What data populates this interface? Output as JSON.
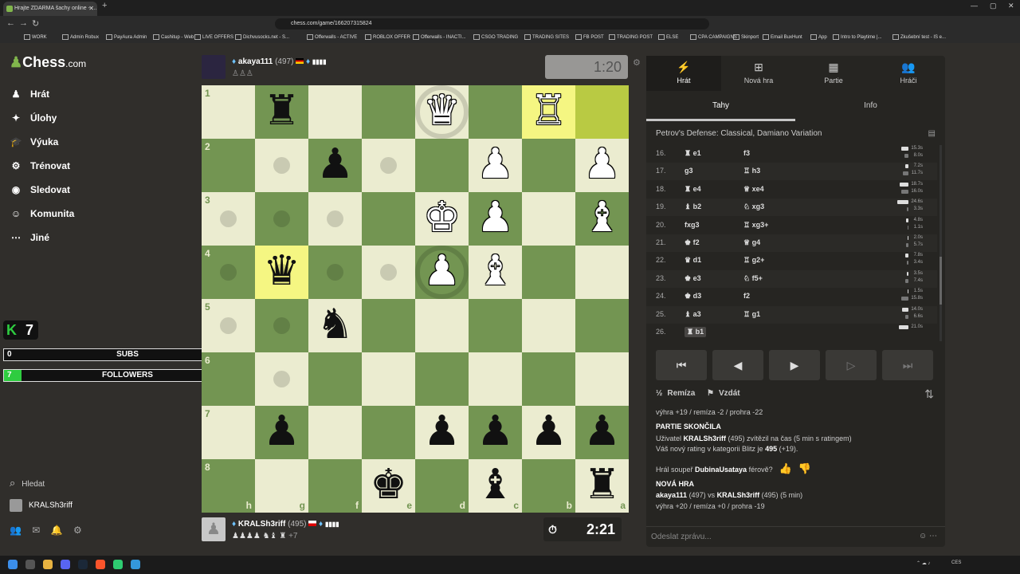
{
  "browser": {
    "tab_title": "Hrajte ZDARMA šachy online - …",
    "url": "chess.com/game/166207315824",
    "bookmarks": [
      "WORK",
      "Admin Robux",
      "PayAura Admin",
      "Cashitup - Web",
      "LIVE OFFERS",
      "Dichvusocks.net - S...",
      "Offerwalls - ACTIVE",
      "ROBLOX OFFER",
      "Offerwalls - INACTI...",
      "CSGO TRADING",
      "TRADING SITES",
      "FB POST",
      "TRADING POST",
      "ELSE",
      "CPA CAMPAIGNS",
      "Skinport",
      "Email BuxHunt",
      "App",
      "Intro to Playtime |...",
      "Zkušební test - IS e..."
    ]
  },
  "sidebar": {
    "logo_main": "Chess",
    "logo_dom": ".com",
    "items": [
      {
        "label": "Hrát",
        "icon": "play-icon"
      },
      {
        "label": "Úlohy",
        "icon": "puzzle-icon"
      },
      {
        "label": "Výuka",
        "icon": "learn-icon"
      },
      {
        "label": "Trénovat",
        "icon": "train-icon"
      },
      {
        "label": "Sledovat",
        "icon": "watch-icon"
      },
      {
        "label": "Komunita",
        "icon": "community-icon"
      },
      {
        "label": "Jiné",
        "icon": "more-icon"
      }
    ],
    "search": "Hledat",
    "username": "KRALSh3riff"
  },
  "overlay": {
    "k_count": "7",
    "subs": {
      "left": "0",
      "label": "SUBS",
      "right": "10",
      "progress": 0
    },
    "followers": {
      "left": "7",
      "label": "FOLLOWERS",
      "right": "100",
      "progress": 0.07
    }
  },
  "top_player": {
    "name": "akaya111",
    "rating": "(497)",
    "clock": "1:20",
    "captures": "♙♙♙"
  },
  "bottom_player": {
    "name": "KRALSh3riff",
    "rating": "(495)",
    "clock": "2:21",
    "captures": "♟♟♟♟ ♞♝ ♜",
    "diff": "+7"
  },
  "board": {
    "ranks": [
      "1",
      "2",
      "3",
      "4",
      "5",
      "6",
      "7",
      "8"
    ],
    "files": [
      "h",
      "g",
      "f",
      "e",
      "d",
      "c",
      "b",
      "a"
    ],
    "highlights": [
      "g4",
      "b1",
      "a1"
    ],
    "dots": [
      "g2",
      "e2",
      "h3",
      "g3",
      "f3",
      "h4",
      "g4_",
      "f4",
      "e4",
      "h5",
      "g5",
      "g6"
    ],
    "rings": [
      "d1",
      "d4"
    ],
    "pieces": [
      {
        "sq": "g1",
        "p": "♜",
        "c": "b"
      },
      {
        "sq": "d1",
        "p": "♛",
        "c": "w"
      },
      {
        "sq": "b1",
        "p": "♖",
        "c": "w"
      },
      {
        "sq": "f2",
        "p": "♟",
        "c": "b"
      },
      {
        "sq": "c2",
        "p": "♟",
        "c": "w"
      },
      {
        "sq": "a2",
        "p": "♟",
        "c": "w"
      },
      {
        "sq": "d3",
        "p": "♚",
        "c": "w"
      },
      {
        "sq": "c3",
        "p": "♟",
        "c": "w"
      },
      {
        "sq": "a3",
        "p": "♝",
        "c": "w"
      },
      {
        "sq": "g4",
        "p": "♛",
        "c": "b"
      },
      {
        "sq": "d4",
        "p": "♟",
        "c": "w"
      },
      {
        "sq": "c4",
        "p": "♝",
        "c": "w"
      },
      {
        "sq": "f5",
        "p": "♞",
        "c": "b"
      },
      {
        "sq": "g7",
        "p": "♟",
        "c": "b"
      },
      {
        "sq": "d7",
        "p": "♟",
        "c": "b"
      },
      {
        "sq": "c7",
        "p": "♟",
        "c": "b"
      },
      {
        "sq": "b7",
        "p": "♟",
        "c": "b"
      },
      {
        "sq": "a7",
        "p": "♟",
        "c": "b"
      },
      {
        "sq": "e8",
        "p": "♚",
        "c": "b"
      },
      {
        "sq": "c8",
        "p": "♝",
        "c": "b"
      },
      {
        "sq": "a8",
        "p": "♜",
        "c": "b"
      }
    ]
  },
  "panel": {
    "tabs": [
      {
        "label": "Hrát",
        "icon": "⚡"
      },
      {
        "label": "Nová hra",
        "icon": "⊞"
      },
      {
        "label": "Partie",
        "icon": "▦"
      },
      {
        "label": "Hráči",
        "icon": "👥"
      }
    ],
    "subtabs": [
      "Tahy",
      "Info"
    ],
    "opening": "Petrov's Defense: Classical, Damiano Variation",
    "moves": [
      {
        "n": "16.",
        "w": "♜ e1",
        "b": "f3",
        "tw": "15.3s",
        "tb": "8.0s",
        "ww": 0.62,
        "wb": 0.33
      },
      {
        "n": "17.",
        "w": "g3",
        "b": "♖ h3",
        "tw": "7.2s",
        "tb": "11.7s",
        "ww": 0.29,
        "wb": 0.48
      },
      {
        "n": "18.",
        "w": "♜ e4",
        "b": "♕ xe4",
        "tw": "18.7s",
        "tb": "16.0s",
        "ww": 0.76,
        "wb": 0.65
      },
      {
        "n": "19.",
        "w": "♝ b2",
        "b": "♘ xg3",
        "tw": "24.6s",
        "tb": "3.3s",
        "ww": 1.0,
        "wb": 0.13
      },
      {
        "n": "20.",
        "w": "fxg3",
        "b": "♖ xg3+",
        "tw": "4.8s",
        "tb": "1.1s",
        "ww": 0.2,
        "wb": 0.05
      },
      {
        "n": "21.",
        "w": "♚ f2",
        "b": "♕ g4",
        "tw": "2.0s",
        "tb": "5.7s",
        "ww": 0.08,
        "wb": 0.23
      },
      {
        "n": "22.",
        "w": "♛ d1",
        "b": "♖ g2+",
        "tw": "7.8s",
        "tb": "3.4s",
        "ww": 0.32,
        "wb": 0.14
      },
      {
        "n": "23.",
        "w": "♚ e3",
        "b": "♘ f5+",
        "tw": "3.5s",
        "tb": "7.4s",
        "ww": 0.14,
        "wb": 0.3
      },
      {
        "n": "24.",
        "w": "♚ d3",
        "b": "f2",
        "tw": "1.5s",
        "tb": "15.8s",
        "ww": 0.06,
        "wb": 0.64
      },
      {
        "n": "25.",
        "w": "♝ a3",
        "b": "♖ g1",
        "tw": "14.0s",
        "tb": "6.6s",
        "ww": 0.57,
        "wb": 0.27
      },
      {
        "n": "26.",
        "w": "♜ b1",
        "b": "",
        "tw": "21.0s",
        "tb": "",
        "ww": 0.85,
        "wb": 0
      }
    ],
    "controls": [
      "⏮",
      "◀",
      "▶",
      "▷",
      "⏭"
    ],
    "draw": "Remíza",
    "resign": "Vzdát",
    "chat": {
      "l1": "výhra +19 / remíza -2 / prohra -22",
      "l2": "PARTIE SKONČILA",
      "l3a": "Uživatel ",
      "l3b": "KRALSh3riff",
      "l3c": " (495) zvítězil na čas (5 min s ratingem)",
      "l4a": "Váš nový rating v kategorii Blitz je ",
      "l4b": "495",
      "l4c": " (+19).",
      "l5a": "Hrál soupeř ",
      "l5b": "DubinaUsataya",
      "l5c": " férově?",
      "l6": "NOVÁ HRA",
      "l7a": "akaya111",
      "l7b": " (497) vs ",
      "l7c": "KRALSh3riff",
      "l7d": " (495) (5 min)",
      "l8": "výhra +20 / remíza +0 / prohra -19"
    },
    "chat_placeholder": "Odeslat zprávu..."
  },
  "taskbar": {
    "lang": "CES"
  }
}
